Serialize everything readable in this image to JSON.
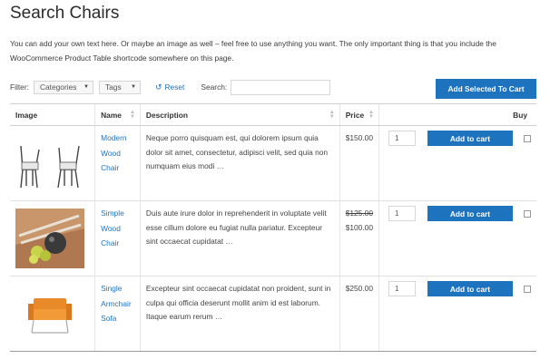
{
  "page": {
    "title": "Search Chairs",
    "intro": "You can add your own text here. Or maybe an image as well – feel free to use anything you want. The only important thing is that you include the WooCommerce Product Table shortcode somewhere on this page."
  },
  "filters": {
    "label": "Filter:",
    "categories": "Categories",
    "tags": "Tags",
    "reset": "Reset",
    "search_label": "Search:",
    "search_value": ""
  },
  "add_selected_label": "Add Selected To Cart",
  "table": {
    "columns": {
      "image": "Image",
      "name": "Name",
      "description": "Description",
      "price": "Price",
      "buy": "Buy"
    },
    "rows": [
      {
        "name": "Modern Wood Chair",
        "description": "Neque porro quisquam est, qui dolorem ipsum quia dolor sit amet, consectetur, adipisci velit, sed quia non numquam eius modi …",
        "price_old": "",
        "price": "$150.00",
        "qty": "1",
        "button": "Add to cart"
      },
      {
        "name": "Simple Wood Chair",
        "description": "Duis aute irure dolor in reprehenderit in voluptate velit esse cillum dolore eu fugiat nulla pariatur. Excepteur sint occaecat cupidatat …",
        "price_old": "$125.00",
        "price": "$100.00",
        "qty": "1",
        "button": "Add to cart"
      },
      {
        "name": "Single Armchair Sofa",
        "description": "Excepteur sint occaecat cupidatat non proident, sunt in culpa qui officia deserunt mollit anim id est laborum. Itaque earum rerum …",
        "price_old": "",
        "price": "$250.00",
        "qty": "1",
        "button": "Add to cart"
      }
    ]
  },
  "colors": {
    "accent": "#1e73be"
  }
}
